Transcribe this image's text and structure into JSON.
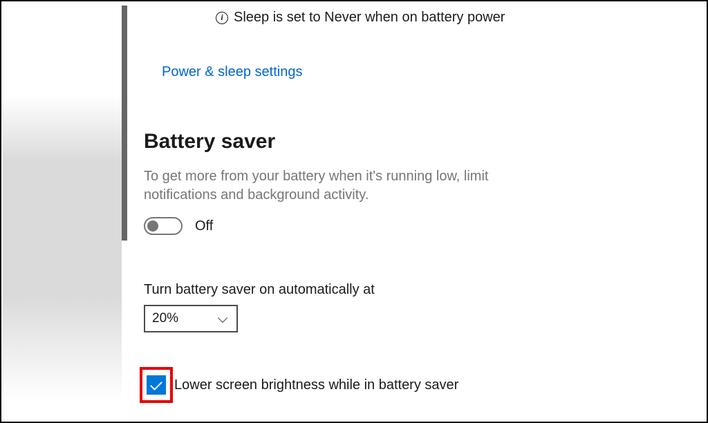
{
  "notice": {
    "text": "Sleep is set to Never when on battery power"
  },
  "link": {
    "power_sleep": "Power & sleep settings"
  },
  "battery_saver": {
    "heading": "Battery saver",
    "description": "To get more from your battery when it's running low, limit notifications and background activity.",
    "toggle_state": "Off",
    "auto_label": "Turn battery saver on automatically at",
    "threshold": "20%",
    "brightness_label": "Lower screen brightness while in battery saver"
  }
}
